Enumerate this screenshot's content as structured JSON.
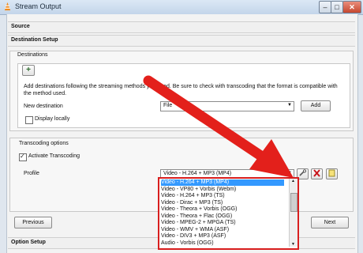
{
  "window": {
    "title": "Stream Output",
    "min_glyph": "–",
    "max_glyph": "□",
    "close_glyph": "✕"
  },
  "sections": {
    "source": "Source",
    "destination_setup": "Destination Setup",
    "option_setup": "Option Setup"
  },
  "destinations": {
    "heading": "Destinations",
    "add_tab_glyph": "+",
    "description": "Add destinations following the streaming methods you need. Be sure to check with transcoding that the format is compatible with the method used.",
    "new_destination_label": "New destination",
    "new_destination_value": "File",
    "add_button": "Add",
    "display_locally_label": "Display locally"
  },
  "transcoding": {
    "heading": "Transcoding options",
    "activate_label": "Activate Transcoding",
    "profile_label": "Profile",
    "profile_value": "Video - H.264 + MP3 (MP4)"
  },
  "profile_options": [
    "Video - H.264 + MP3 (MP4)",
    "Video - VP80 + Vorbis (Webm)",
    "Video - H.264 + MP3 (TS)",
    "Video - Dirac + MP3 (TS)",
    "Video - Theora + Vorbis (OGG)",
    "Video - Theora + Flac (OGG)",
    "Video - MPEG-2 + MPGA (TS)",
    "Video - WMV + WMA (ASF)",
    "Video - DIV3 + MP3 (ASF)",
    "Audio - Vorbis (OGG)"
  ],
  "nav": {
    "previous": "Previous",
    "next": "Next"
  },
  "colors": {
    "annotation_red": "#e3201b",
    "selection_blue": "#3399ff"
  }
}
